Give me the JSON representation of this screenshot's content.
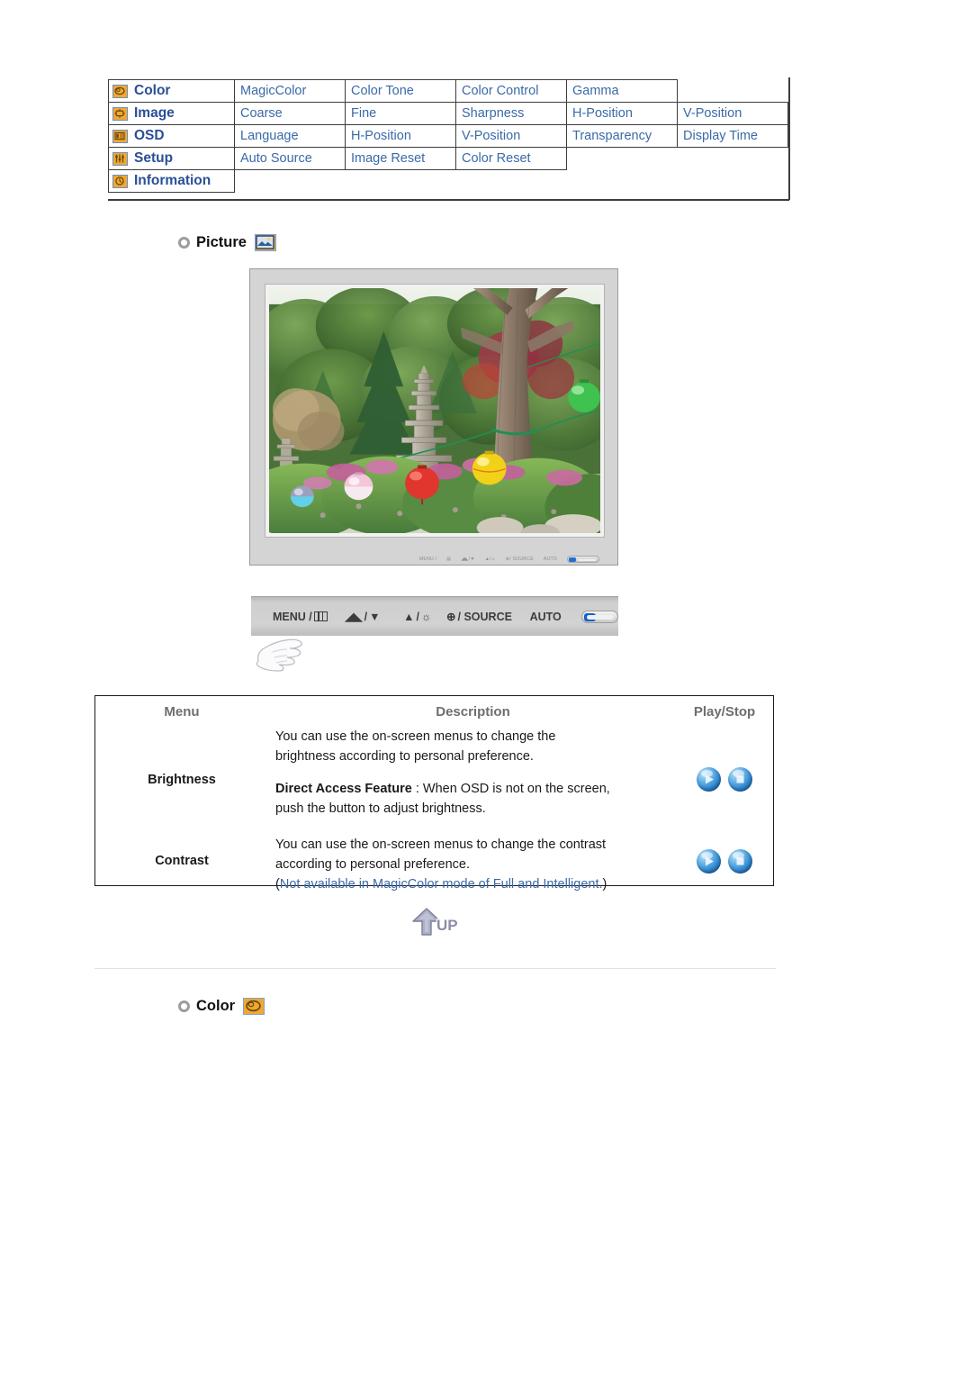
{
  "osd_menu": {
    "rows": [
      {
        "category": "Color",
        "icon": "color-wheel-icon",
        "options": [
          "MagicColor",
          "Color Tone",
          "Color Control",
          "Gamma"
        ]
      },
      {
        "category": "Image",
        "icon": "image-icon",
        "options": [
          "Coarse",
          "Fine",
          "Sharpness",
          "H-Position",
          "V-Position"
        ]
      },
      {
        "category": "OSD",
        "icon": "osd-icon",
        "options": [
          "Language",
          "H-Position",
          "V-Position",
          "Transparency",
          "Display Time"
        ]
      },
      {
        "category": "Setup",
        "icon": "setup-sliders-icon",
        "options": [
          "Auto Source",
          "Image Reset",
          "Color Reset"
        ]
      },
      {
        "category": "Information",
        "icon": "information-icon",
        "options": []
      }
    ]
  },
  "picture_section": {
    "heading": "Picture",
    "icon": "picture-thumbnail-icon"
  },
  "color_section": {
    "heading": "Color",
    "icon": "color-wheel-icon"
  },
  "monitor": {
    "bezel_controls": [
      "MENU /",
      "/",
      "/",
      "/ SOURCE",
      "AUTO"
    ],
    "photo_alt": "korean-garden-stone-pagoda-with-paper-lanterns"
  },
  "control_panel": {
    "menu_label": "MENU /",
    "magic_label": "/",
    "up_label": "/",
    "source_label": "/ SOURCE",
    "auto_label": "AUTO",
    "down_arrow": "▼",
    "up_arrow": "▲",
    "brightness_glyph": "☼",
    "source_glyph": "⊕",
    "magic_glyph": "◢◣"
  },
  "description_table": {
    "headers": {
      "menu": "Menu",
      "description": "Description",
      "play_stop": "Play/Stop"
    },
    "rows": [
      {
        "menu": "Brightness",
        "line1": "You can use the on-screen menus to change the",
        "line2": "brightness according to personal preference.",
        "feature_label": "Direct Access Feature",
        "feature_line1": " : When OSD is not on the screen,",
        "feature_line2": "push the button to adjust brightness.",
        "play_icon": "play-orb-icon",
        "stop_icon": "stop-orb-icon"
      },
      {
        "menu": "Contrast",
        "line1": "You can use the on-screen menus to change the contrast",
        "line2": "according to personal preference.",
        "note_open": "(",
        "note": "Not available in MagicColor mode of Full and Intelligent.",
        "note_close": ")",
        "play_icon": "play-orb-icon",
        "stop_icon": "stop-orb-icon"
      }
    ]
  },
  "up_button": {
    "label": "UP",
    "icon": "up-arrow-icon"
  },
  "colors": {
    "menu_link": "#3a6aa8",
    "category_text": "#2a4f96",
    "icon_fill": "#f0a830",
    "icon_border": "#7ea3d0",
    "table_border": "#3d3d3d",
    "header_gray": "#6e6e6e",
    "orb_blue": "#2f86cf",
    "up_button": "#9a9ab4"
  }
}
